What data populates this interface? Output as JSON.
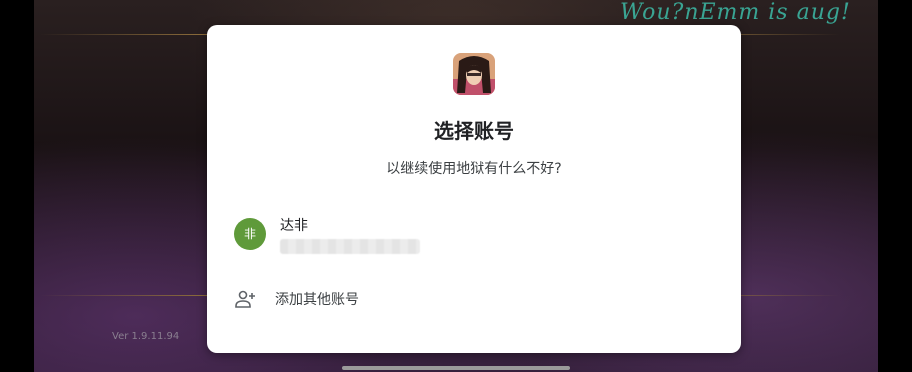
{
  "background": {
    "title_art": "Wou?nEmm is aug!",
    "version": "Ver 1.9.11.94"
  },
  "dialog": {
    "app_icon": "app-character-icon",
    "title": "选择账号",
    "subtitle": "以继续使用地狱有什么不好?",
    "account": {
      "avatar_initial": "非",
      "avatar_color": "#5f9a3a",
      "name": "达非",
      "email": ""
    },
    "add_account": {
      "icon": "person-add-icon",
      "label": "添加其他账号"
    }
  }
}
